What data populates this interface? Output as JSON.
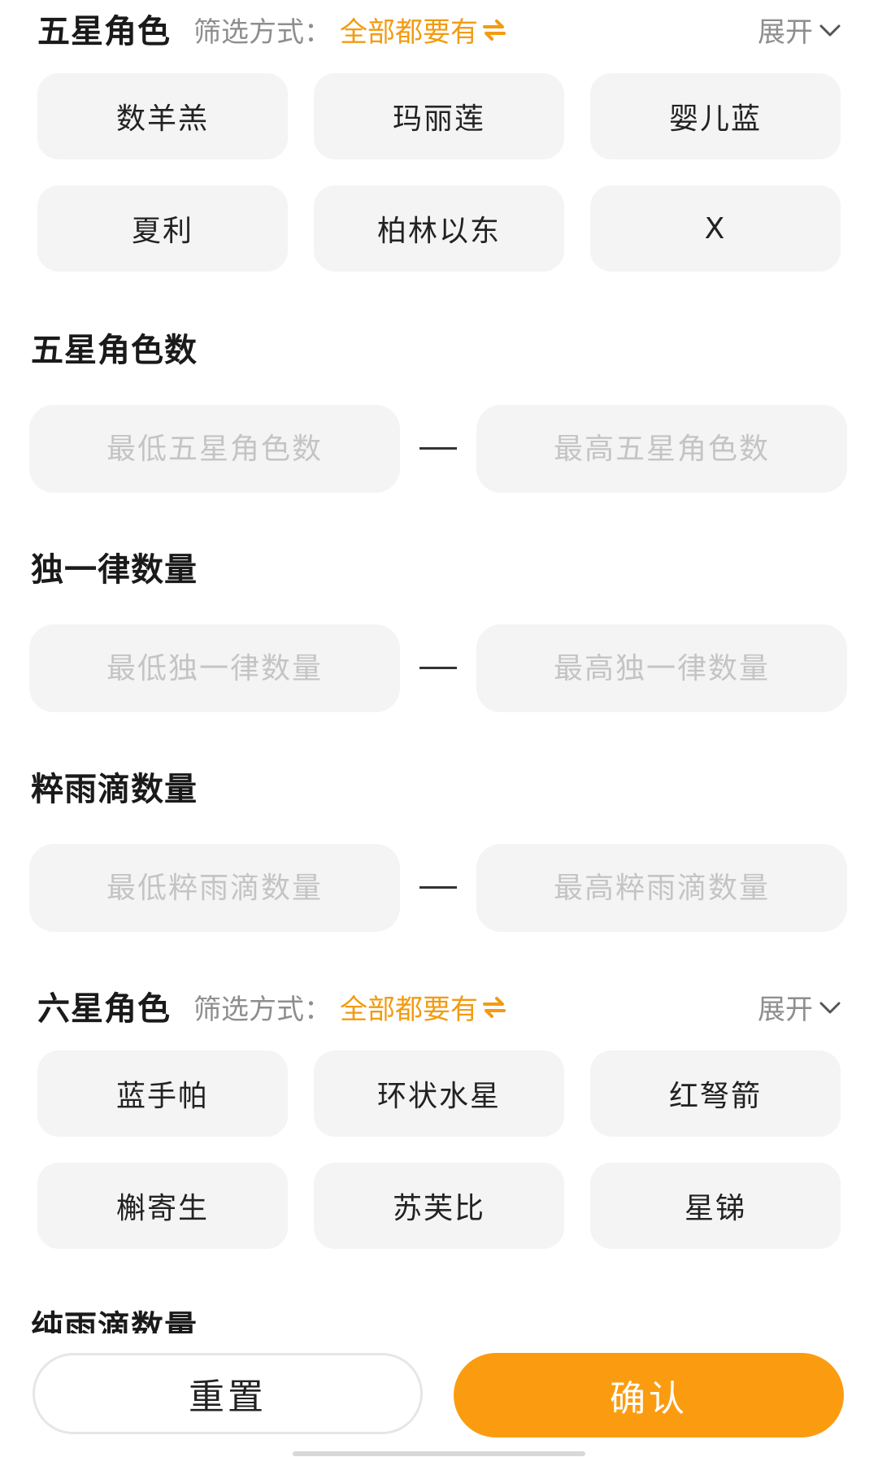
{
  "five_star": {
    "title": "五星角色",
    "filter_label": "筛选方式：",
    "filter_value": "全部都要有",
    "expand_label": "展开",
    "tags": [
      "数羊羔",
      "玛丽莲",
      "婴儿蓝",
      "夏利",
      "柏林以东",
      "X"
    ]
  },
  "five_star_count": {
    "title": "五星角色数",
    "min_placeholder": "最低五星角色数",
    "max_placeholder": "最高五星角色数"
  },
  "unique_count": {
    "title": "独一律数量",
    "min_placeholder": "最低独一律数量",
    "max_placeholder": "最高独一律数量"
  },
  "pure_rain_count": {
    "title": "粹雨滴数量",
    "min_placeholder": "最低粹雨滴数量",
    "max_placeholder": "最高粹雨滴数量"
  },
  "six_star": {
    "title": "六星角色",
    "filter_label": "筛选方式：",
    "filter_value": "全部都要有",
    "expand_label": "展开",
    "tags": [
      "蓝手帕",
      "环状水星",
      "红弩箭",
      "槲寄生",
      "苏芙比",
      "星锑"
    ]
  },
  "next_section_title": "纯雨滴数量",
  "actions": {
    "reset_label": "重置",
    "confirm_label": "确认"
  },
  "colors": {
    "accent": "#f29b11",
    "confirm_bg": "#fb9c10",
    "tag_bg": "#f4f4f4",
    "placeholder": "#c4c4c4"
  }
}
